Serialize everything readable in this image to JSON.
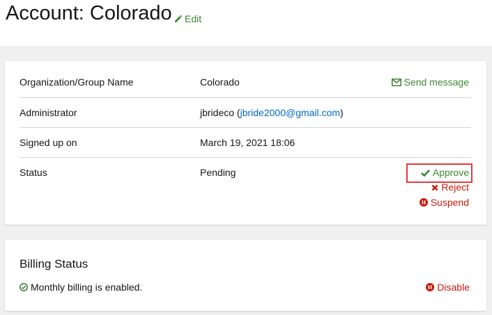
{
  "header": {
    "title": "Account: Colorado",
    "edit_label": "Edit"
  },
  "details": {
    "rows": [
      {
        "label": "Organization/Group Name",
        "value": "Colorado",
        "action": "Send message"
      },
      {
        "label": "Administrator",
        "value_prefix": "jbrideco (",
        "email": "jbride2000@gmail.com",
        "value_suffix": ")"
      },
      {
        "label": "Signed up on",
        "value": "March 19, 2021 18:06"
      },
      {
        "label": "Status",
        "value": "Pending"
      }
    ],
    "status_actions": {
      "approve": "Approve",
      "reject": "Reject",
      "suspend": "Suspend"
    }
  },
  "billing": {
    "title": "Billing Status",
    "status_text": "Monthly billing is enabled.",
    "disable_label": "Disable"
  },
  "colors": {
    "success": "#3e8635",
    "danger": "#c9190b",
    "link": "#0066cc",
    "highlight_box": "#e03a3a"
  },
  "icons": [
    "pencil-icon",
    "envelope-icon",
    "check-icon",
    "times-icon",
    "pause-circle-icon",
    "check-circle-icon"
  ]
}
